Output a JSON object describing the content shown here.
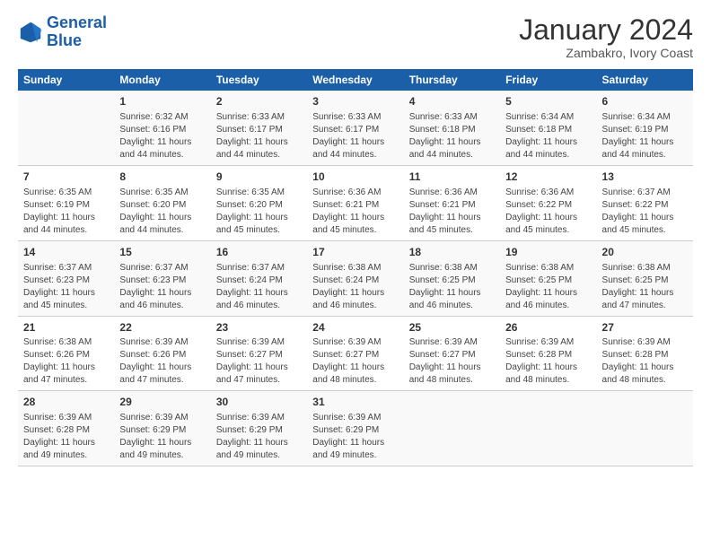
{
  "logo": {
    "line1": "General",
    "line2": "Blue"
  },
  "title": "January 2024",
  "subtitle": "Zambakro, Ivory Coast",
  "days_header": [
    "Sunday",
    "Monday",
    "Tuesday",
    "Wednesday",
    "Thursday",
    "Friday",
    "Saturday"
  ],
  "weeks": [
    [
      {
        "day": "",
        "sunrise": "",
        "sunset": "",
        "daylight": ""
      },
      {
        "day": "1",
        "sunrise": "Sunrise: 6:32 AM",
        "sunset": "Sunset: 6:16 PM",
        "daylight": "Daylight: 11 hours and 44 minutes."
      },
      {
        "day": "2",
        "sunrise": "Sunrise: 6:33 AM",
        "sunset": "Sunset: 6:17 PM",
        "daylight": "Daylight: 11 hours and 44 minutes."
      },
      {
        "day": "3",
        "sunrise": "Sunrise: 6:33 AM",
        "sunset": "Sunset: 6:17 PM",
        "daylight": "Daylight: 11 hours and 44 minutes."
      },
      {
        "day": "4",
        "sunrise": "Sunrise: 6:33 AM",
        "sunset": "Sunset: 6:18 PM",
        "daylight": "Daylight: 11 hours and 44 minutes."
      },
      {
        "day": "5",
        "sunrise": "Sunrise: 6:34 AM",
        "sunset": "Sunset: 6:18 PM",
        "daylight": "Daylight: 11 hours and 44 minutes."
      },
      {
        "day": "6",
        "sunrise": "Sunrise: 6:34 AM",
        "sunset": "Sunset: 6:19 PM",
        "daylight": "Daylight: 11 hours and 44 minutes."
      }
    ],
    [
      {
        "day": "7",
        "sunrise": "Sunrise: 6:35 AM",
        "sunset": "Sunset: 6:19 PM",
        "daylight": "Daylight: 11 hours and 44 minutes."
      },
      {
        "day": "8",
        "sunrise": "Sunrise: 6:35 AM",
        "sunset": "Sunset: 6:20 PM",
        "daylight": "Daylight: 11 hours and 44 minutes."
      },
      {
        "day": "9",
        "sunrise": "Sunrise: 6:35 AM",
        "sunset": "Sunset: 6:20 PM",
        "daylight": "Daylight: 11 hours and 45 minutes."
      },
      {
        "day": "10",
        "sunrise": "Sunrise: 6:36 AM",
        "sunset": "Sunset: 6:21 PM",
        "daylight": "Daylight: 11 hours and 45 minutes."
      },
      {
        "day": "11",
        "sunrise": "Sunrise: 6:36 AM",
        "sunset": "Sunset: 6:21 PM",
        "daylight": "Daylight: 11 hours and 45 minutes."
      },
      {
        "day": "12",
        "sunrise": "Sunrise: 6:36 AM",
        "sunset": "Sunset: 6:22 PM",
        "daylight": "Daylight: 11 hours and 45 minutes."
      },
      {
        "day": "13",
        "sunrise": "Sunrise: 6:37 AM",
        "sunset": "Sunset: 6:22 PM",
        "daylight": "Daylight: 11 hours and 45 minutes."
      }
    ],
    [
      {
        "day": "14",
        "sunrise": "Sunrise: 6:37 AM",
        "sunset": "Sunset: 6:23 PM",
        "daylight": "Daylight: 11 hours and 45 minutes."
      },
      {
        "day": "15",
        "sunrise": "Sunrise: 6:37 AM",
        "sunset": "Sunset: 6:23 PM",
        "daylight": "Daylight: 11 hours and 46 minutes."
      },
      {
        "day": "16",
        "sunrise": "Sunrise: 6:37 AM",
        "sunset": "Sunset: 6:24 PM",
        "daylight": "Daylight: 11 hours and 46 minutes."
      },
      {
        "day": "17",
        "sunrise": "Sunrise: 6:38 AM",
        "sunset": "Sunset: 6:24 PM",
        "daylight": "Daylight: 11 hours and 46 minutes."
      },
      {
        "day": "18",
        "sunrise": "Sunrise: 6:38 AM",
        "sunset": "Sunset: 6:25 PM",
        "daylight": "Daylight: 11 hours and 46 minutes."
      },
      {
        "day": "19",
        "sunrise": "Sunrise: 6:38 AM",
        "sunset": "Sunset: 6:25 PM",
        "daylight": "Daylight: 11 hours and 46 minutes."
      },
      {
        "day": "20",
        "sunrise": "Sunrise: 6:38 AM",
        "sunset": "Sunset: 6:25 PM",
        "daylight": "Daylight: 11 hours and 47 minutes."
      }
    ],
    [
      {
        "day": "21",
        "sunrise": "Sunrise: 6:38 AM",
        "sunset": "Sunset: 6:26 PM",
        "daylight": "Daylight: 11 hours and 47 minutes."
      },
      {
        "day": "22",
        "sunrise": "Sunrise: 6:39 AM",
        "sunset": "Sunset: 6:26 PM",
        "daylight": "Daylight: 11 hours and 47 minutes."
      },
      {
        "day": "23",
        "sunrise": "Sunrise: 6:39 AM",
        "sunset": "Sunset: 6:27 PM",
        "daylight": "Daylight: 11 hours and 47 minutes."
      },
      {
        "day": "24",
        "sunrise": "Sunrise: 6:39 AM",
        "sunset": "Sunset: 6:27 PM",
        "daylight": "Daylight: 11 hours and 48 minutes."
      },
      {
        "day": "25",
        "sunrise": "Sunrise: 6:39 AM",
        "sunset": "Sunset: 6:27 PM",
        "daylight": "Daylight: 11 hours and 48 minutes."
      },
      {
        "day": "26",
        "sunrise": "Sunrise: 6:39 AM",
        "sunset": "Sunset: 6:28 PM",
        "daylight": "Daylight: 11 hours and 48 minutes."
      },
      {
        "day": "27",
        "sunrise": "Sunrise: 6:39 AM",
        "sunset": "Sunset: 6:28 PM",
        "daylight": "Daylight: 11 hours and 48 minutes."
      }
    ],
    [
      {
        "day": "28",
        "sunrise": "Sunrise: 6:39 AM",
        "sunset": "Sunset: 6:28 PM",
        "daylight": "Daylight: 11 hours and 49 minutes."
      },
      {
        "day": "29",
        "sunrise": "Sunrise: 6:39 AM",
        "sunset": "Sunset: 6:29 PM",
        "daylight": "Daylight: 11 hours and 49 minutes."
      },
      {
        "day": "30",
        "sunrise": "Sunrise: 6:39 AM",
        "sunset": "Sunset: 6:29 PM",
        "daylight": "Daylight: 11 hours and 49 minutes."
      },
      {
        "day": "31",
        "sunrise": "Sunrise: 6:39 AM",
        "sunset": "Sunset: 6:29 PM",
        "daylight": "Daylight: 11 hours and 49 minutes."
      },
      {
        "day": "",
        "sunrise": "",
        "sunset": "",
        "daylight": ""
      },
      {
        "day": "",
        "sunrise": "",
        "sunset": "",
        "daylight": ""
      },
      {
        "day": "",
        "sunrise": "",
        "sunset": "",
        "daylight": ""
      }
    ]
  ]
}
